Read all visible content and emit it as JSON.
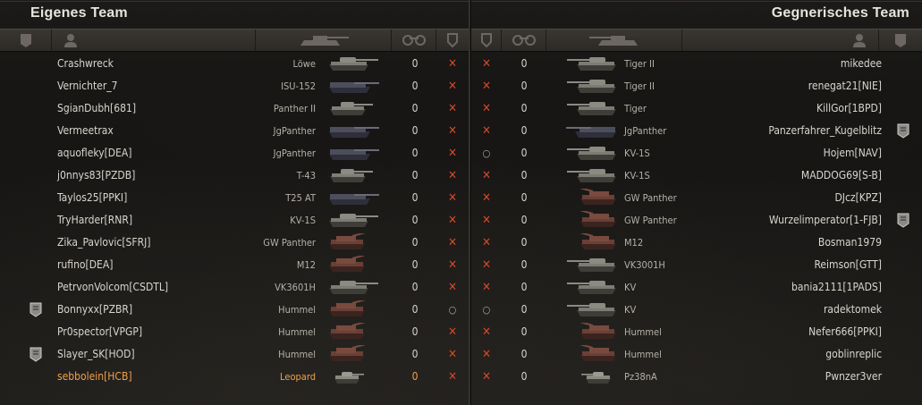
{
  "own_team": {
    "title": "Eigenes Team",
    "players": [
      {
        "name": "Crashwreck",
        "vehicle": "Löwe",
        "frags": "0",
        "status": "dead",
        "type": "heavy",
        "badge": false,
        "me": false
      },
      {
        "name": "Vernichter_7",
        "vehicle": "ISU-152",
        "frags": "0",
        "status": "dead",
        "type": "td",
        "badge": false,
        "me": false
      },
      {
        "name": "SgianDubh[681]",
        "vehicle": "Panther II",
        "frags": "0",
        "status": "dead",
        "type": "medium",
        "badge": false,
        "me": false
      },
      {
        "name": "Vermeetrax",
        "vehicle": "JgPanther",
        "frags": "0",
        "status": "dead",
        "type": "td",
        "badge": false,
        "me": false
      },
      {
        "name": "aquofleky[DEA]",
        "vehicle": "JgPanther",
        "frags": "0",
        "status": "dead",
        "type": "td",
        "badge": false,
        "me": false
      },
      {
        "name": "j0nnys83[PZDB]",
        "vehicle": "T-43",
        "frags": "0",
        "status": "dead",
        "type": "medium",
        "badge": false,
        "me": false
      },
      {
        "name": "Taylos25[PPKI]",
        "vehicle": "T25 AT",
        "frags": "0",
        "status": "dead",
        "type": "td",
        "badge": false,
        "me": false
      },
      {
        "name": "TryHarder[RNR]",
        "vehicle": "KV-1S",
        "frags": "0",
        "status": "dead",
        "type": "heavy",
        "badge": false,
        "me": false
      },
      {
        "name": "Zika_Pavlovic[SFRJ]",
        "vehicle": "GW Panther",
        "frags": "0",
        "status": "dead",
        "type": "spg",
        "badge": false,
        "me": false
      },
      {
        "name": "rufino[DEA]",
        "vehicle": "M12",
        "frags": "0",
        "status": "dead",
        "type": "spg",
        "badge": false,
        "me": false
      },
      {
        "name": "PetrvonVolcom[CSDTL]",
        "vehicle": "VK3601H",
        "frags": "0",
        "status": "dead",
        "type": "heavy",
        "badge": false,
        "me": false
      },
      {
        "name": "Bonnyxx[PZBR]",
        "vehicle": "Hummel",
        "frags": "0",
        "status": "alive",
        "type": "spg",
        "badge": true,
        "me": false
      },
      {
        "name": "Pr0spector[VPGP]",
        "vehicle": "Hummel",
        "frags": "0",
        "status": "dead",
        "type": "spg",
        "badge": false,
        "me": false
      },
      {
        "name": "Slayer_SK[HOD]",
        "vehicle": "Hummel",
        "frags": "0",
        "status": "dead",
        "type": "spg",
        "badge": true,
        "me": false
      },
      {
        "name": "sebbolein[HCB]",
        "vehicle": "Leopard",
        "frags": "0",
        "status": "dead",
        "type": "light",
        "badge": false,
        "me": true
      }
    ]
  },
  "enemy_team": {
    "title": "Gegnerisches Team",
    "players": [
      {
        "name": "mikedee",
        "vehicle": "Tiger II",
        "frags": "0",
        "status": "dead",
        "type": "heavy",
        "badge": false
      },
      {
        "name": "renegat21[NIE]",
        "vehicle": "Tiger II",
        "frags": "0",
        "status": "dead",
        "type": "heavy",
        "badge": false
      },
      {
        "name": "KillGor[1BPD]",
        "vehicle": "Tiger",
        "frags": "0",
        "status": "dead",
        "type": "heavy",
        "badge": false
      },
      {
        "name": "Panzerfahrer_Kugelblitz",
        "vehicle": "JgPanther",
        "frags": "0",
        "status": "dead",
        "type": "td",
        "badge": true
      },
      {
        "name": "Hojem[NAV]",
        "vehicle": "KV-1S",
        "frags": "0",
        "status": "alive",
        "type": "heavy",
        "badge": false
      },
      {
        "name": "MADDOG69[S-B]",
        "vehicle": "KV-1S",
        "frags": "0",
        "status": "dead",
        "type": "heavy",
        "badge": false
      },
      {
        "name": "DJcz[KPZ]",
        "vehicle": "GW Panther",
        "frags": "0",
        "status": "dead",
        "type": "spg",
        "badge": false
      },
      {
        "name": "Wurzelimperator[1-FJB]",
        "vehicle": "GW Panther",
        "frags": "0",
        "status": "dead",
        "type": "spg",
        "badge": true
      },
      {
        "name": "Bosman1979",
        "vehicle": "M12",
        "frags": "0",
        "status": "dead",
        "type": "spg",
        "badge": false
      },
      {
        "name": "Reimson[GTT]",
        "vehicle": "VK3001H",
        "frags": "0",
        "status": "dead",
        "type": "heavy",
        "badge": false
      },
      {
        "name": "bania2111[1PADS]",
        "vehicle": "KV",
        "frags": "0",
        "status": "dead",
        "type": "heavy",
        "badge": false
      },
      {
        "name": "radektomek",
        "vehicle": "KV",
        "frags": "0",
        "status": "alive",
        "type": "heavy",
        "badge": false
      },
      {
        "name": "Nefer666[PPKI]",
        "vehicle": "Hummel",
        "frags": "0",
        "status": "dead",
        "type": "spg",
        "badge": false
      },
      {
        "name": "goblinreplic",
        "vehicle": "Hummel",
        "frags": "0",
        "status": "dead",
        "type": "spg",
        "badge": false
      },
      {
        "name": "Pwnzer3ver",
        "vehicle": "Pz38nA",
        "frags": "0",
        "status": "dead",
        "type": "light",
        "badge": false
      }
    ]
  },
  "colors": {
    "own_player": "#f0a04a",
    "destroyed_marker": "#d44a2a",
    "spg_tint": "#6a4036",
    "tank_tint": "#8a8a80"
  }
}
